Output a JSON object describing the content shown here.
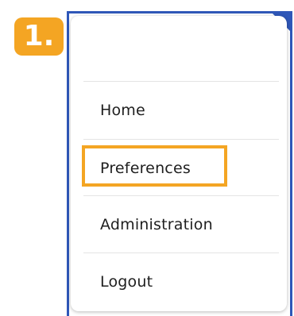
{
  "step_badge": {
    "label": "1."
  },
  "menu": {
    "items": [
      {
        "label": "Home"
      },
      {
        "label": "Preferences"
      },
      {
        "label": "Administration"
      },
      {
        "label": "Logout"
      }
    ],
    "highlighted_item": "Preferences"
  },
  "colors": {
    "accent_orange": "#f4a523",
    "window_border_blue": "#2f57b8",
    "menu_text": "#1e1e1e",
    "divider": "#e4e4e4"
  }
}
